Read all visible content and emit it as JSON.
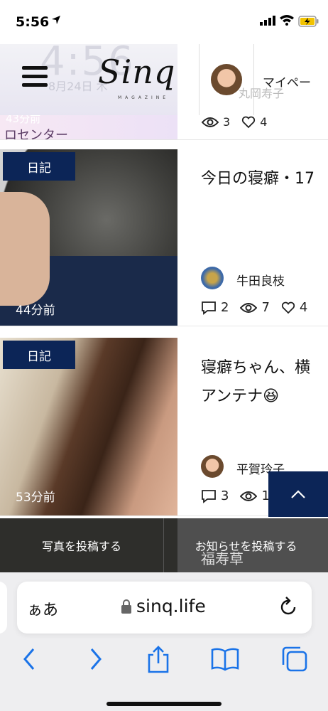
{
  "status_bar": {
    "time": "5:56"
  },
  "header": {
    "logo_text": "Sinq",
    "logo_sub": "MAGAZINE",
    "mypage_label": "マイペー",
    "ghost_clock": "4:56",
    "ghost_date": "8月24日 木",
    "ghost_name": "丸岡寿子"
  },
  "prev_card": {
    "ago": "43分前",
    "partial_text": "ロセンター",
    "views": "3",
    "likes": "4"
  },
  "cards": [
    {
      "badge": "日記",
      "ago": "44分前",
      "title": "今日の寝癖・17",
      "author": "牛田良枝",
      "comments": "2",
      "views": "7",
      "likes": "4"
    },
    {
      "badge": "日記",
      "ago": "53分前",
      "title": "寝癖ちゃん、横アンテナ😆",
      "author": "平賀玲子",
      "comments": "3",
      "views": "1"
    }
  ],
  "next_card": {
    "title": "福寿草"
  },
  "post_bar": {
    "photo_label": "写真を投稿する",
    "notice_label": "お知らせを投稿する"
  },
  "safari": {
    "aa_label": "ぁあ",
    "domain": "sinq.life"
  },
  "colors": {
    "badge_navy": "#0c2557",
    "post_bar_bg": "#2a2a2a",
    "safari_blue": "#1a73e8"
  },
  "icons": [
    "location-arrow-icon",
    "signal-icon",
    "wifi-icon",
    "battery-charging-icon",
    "hamburger-icon",
    "comment-icon",
    "eye-icon",
    "heart-icon",
    "chevron-up-icon",
    "lock-icon",
    "reload-icon",
    "back-icon",
    "forward-icon",
    "share-icon",
    "bookmarks-icon",
    "tabs-icon"
  ]
}
